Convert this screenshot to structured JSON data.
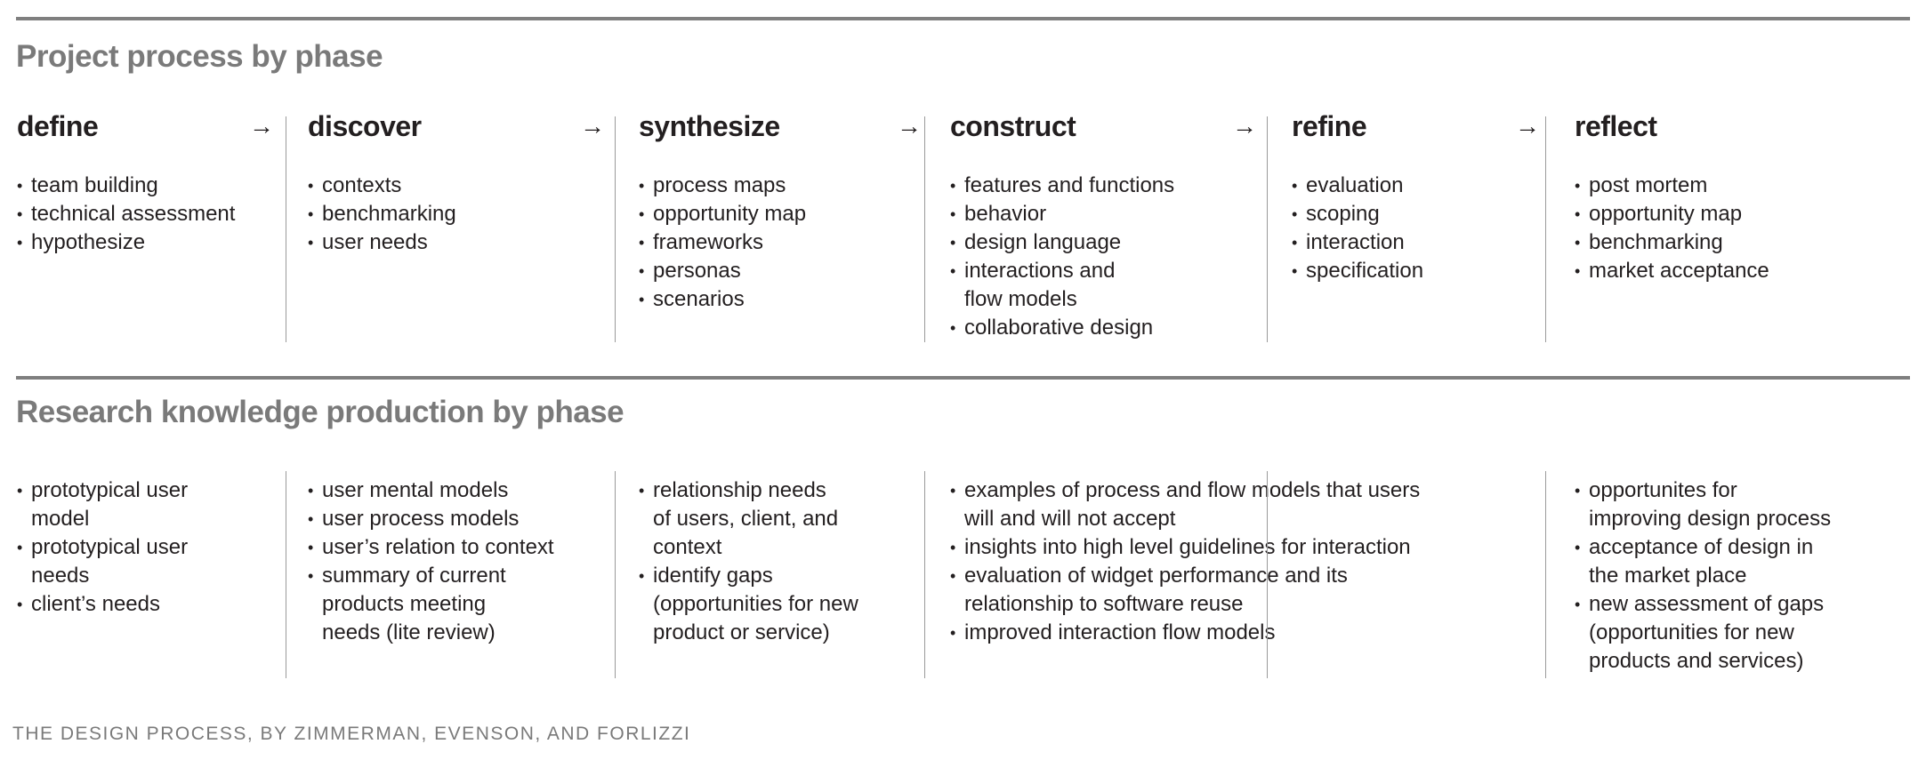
{
  "section1": {
    "title": "Project process by phase",
    "phases": [
      {
        "name": "define",
        "arrow": "→",
        "items": [
          [
            "team building"
          ],
          [
            "technical assessment"
          ],
          [
            "hypothesize"
          ]
        ]
      },
      {
        "name": "discover",
        "arrow": "→",
        "items": [
          [
            "contexts"
          ],
          [
            "benchmarking"
          ],
          [
            "user needs"
          ]
        ]
      },
      {
        "name": "synthesize",
        "arrow": "→",
        "items": [
          [
            "process maps"
          ],
          [
            "opportunity map"
          ],
          [
            "frameworks"
          ],
          [
            "personas"
          ],
          [
            "scenarios"
          ]
        ]
      },
      {
        "name": "construct",
        "arrow": "→",
        "items": [
          [
            "features and functions"
          ],
          [
            "behavior"
          ],
          [
            "design language"
          ],
          [
            "interactions and",
            "flow models"
          ],
          [
            "collaborative design"
          ]
        ]
      },
      {
        "name": "refine",
        "arrow": "→",
        "items": [
          [
            "evaluation"
          ],
          [
            "scoping"
          ],
          [
            "interaction"
          ],
          [
            "specification"
          ]
        ]
      },
      {
        "name": "reflect",
        "arrow": "",
        "items": [
          [
            "post mortem"
          ],
          [
            "opportunity map"
          ],
          [
            "benchmarking"
          ],
          [
            "market acceptance"
          ]
        ]
      }
    ]
  },
  "section2": {
    "title": "Research knowledge production by phase",
    "columns": [
      {
        "items": [
          [
            "prototypical user",
            "model"
          ],
          [
            "prototypical user",
            "needs"
          ],
          [
            "client’s needs"
          ]
        ]
      },
      {
        "items": [
          [
            "user mental models"
          ],
          [
            "user process models"
          ],
          [
            "user’s relation to context"
          ],
          [
            "summary of current",
            "products meeting",
            "needs (lite review)"
          ]
        ]
      },
      {
        "items": [
          [
            "relationship needs",
            "of users, client, and",
            "context"
          ],
          [
            "identify gaps",
            "(opportunities for new",
            "product or service)"
          ]
        ]
      },
      {
        "items": [
          [
            "examples of process and flow models that users",
            "will and will not accept"
          ],
          [
            "insights into high level guidelines for interaction"
          ],
          [
            "evaluation of widget performance and its",
            "relationship to software reuse"
          ],
          [
            "improved interaction flow models"
          ]
        ]
      },
      {
        "items": []
      },
      {
        "items": [
          [
            "opportunites for",
            "improving design process"
          ],
          [
            "acceptance of design in",
            "the market place"
          ],
          [
            "new assessment of gaps",
            "(opportunities for new",
            "products and services)"
          ]
        ]
      }
    ]
  },
  "footer": "THE DESIGN PROCESS, BY ZIMMERMAN, EVENSON, AND FORLIZZI"
}
